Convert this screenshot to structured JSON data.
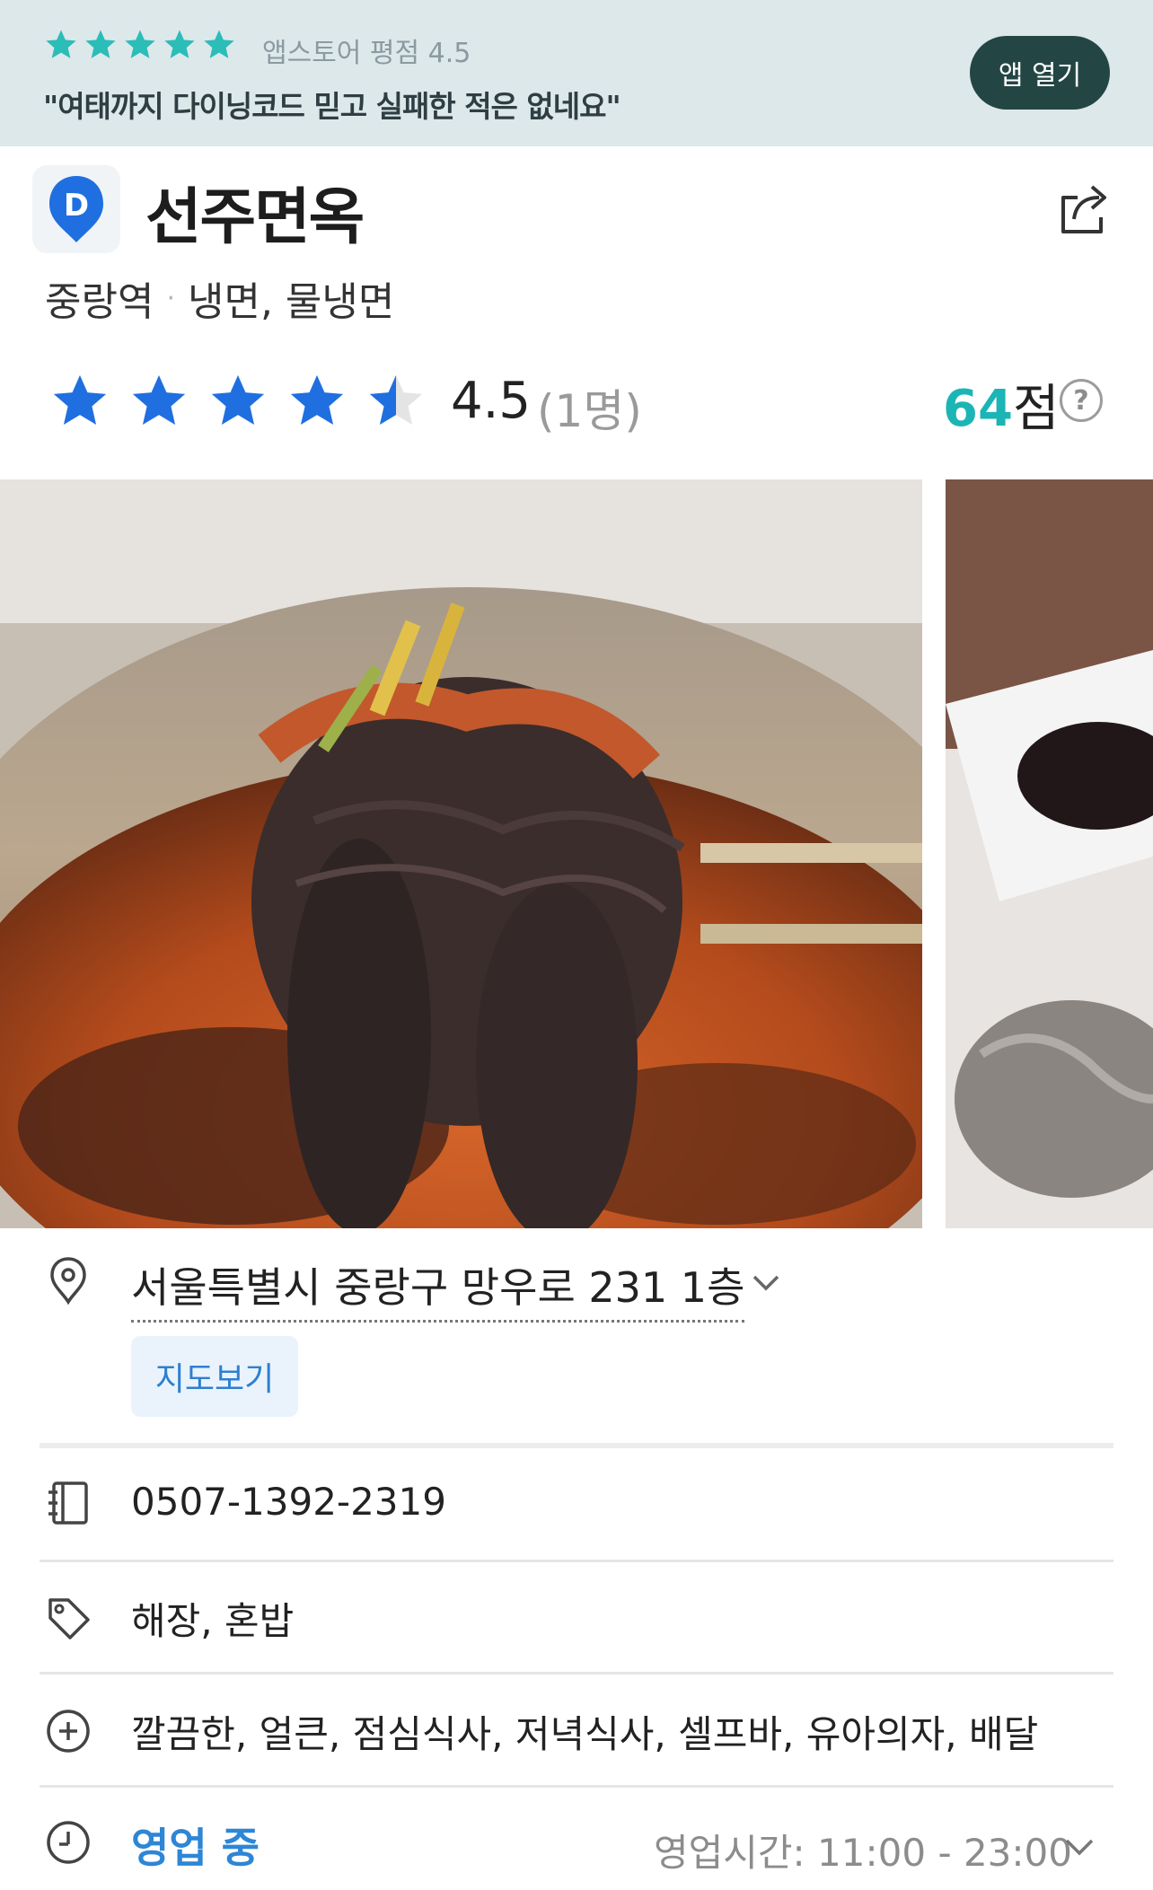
{
  "banner": {
    "rating_text": "앱스토어 평점 4.5",
    "quote": "\"여태까지 다이닝코드 믿고 실패한 적은 없네요\"",
    "open_app_label": "앱 열기",
    "star_color": "#2bbdb8"
  },
  "restaurant": {
    "logo_letter": "D",
    "name": "선주면옥",
    "station": "중랑역",
    "separator": "·",
    "categories": "냉면, 물냉면",
    "rating": "4.5",
    "rating_count": "(1명)",
    "rating_value": 4.5,
    "score_num": "64",
    "score_unit": "점",
    "help_mark": "?"
  },
  "photos": {
    "main_alt": "bibim naengmyeon noodles lifted with chopsticks",
    "side_alt": "dumpling with dipping sauce"
  },
  "info": {
    "address": "서울특별시 중랑구 망우로 231 1층",
    "map_button": "지도보기",
    "phone": "0507-1392-2319",
    "tags": "해장, 혼밥",
    "features": "깔끔한, 얼큰, 점심식사, 저녁식사, 셀프바, 유아의자, 배달",
    "status": "영업 중",
    "hours": "영업시간: 11:00 - 23:00"
  },
  "icons": {
    "pin": "location-pin-icon",
    "phone": "phonebook-icon",
    "tag": "tag-icon",
    "plus": "plus-circle-icon",
    "clock": "clock-icon",
    "share": "share-icon",
    "chevron": "chevron-down-icon"
  },
  "colors": {
    "accent_blue": "#2d86d6",
    "score_teal": "#1cb5b5",
    "star_blue": "#1f6fe0",
    "banner_bg": "#dde8ea"
  }
}
